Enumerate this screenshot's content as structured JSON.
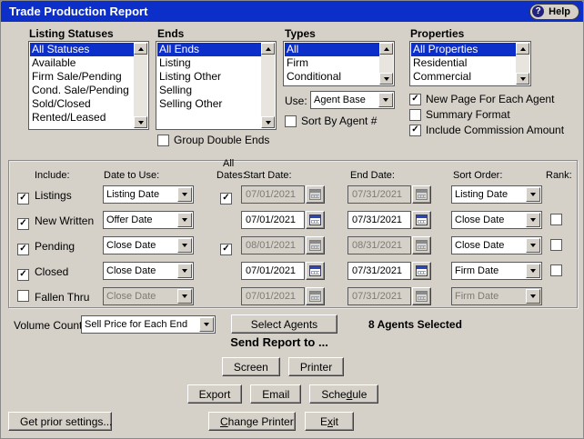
{
  "window": {
    "title": "Trade Production Report",
    "help_label": "Help",
    "help_icon": "?"
  },
  "colors": {
    "titlebar": "#0d2fc9",
    "selection": "#0d2fc9",
    "dialog_bg": "#d5d1c9"
  },
  "lists": {
    "listing_statuses": {
      "label": "Listing Statuses",
      "items": [
        "All Statuses",
        "Available",
        "Firm Sale/Pending",
        "Cond. Sale/Pending",
        "Sold/Closed",
        "Rented/Leased"
      ],
      "selected_index": 0
    },
    "ends": {
      "label": "Ends",
      "items": [
        "All Ends",
        "Listing",
        "Listing Other",
        "Selling",
        "Selling Other"
      ],
      "selected_index": 0,
      "checkbox": {
        "label": "Group Double Ends",
        "checked": false
      }
    },
    "types": {
      "label": "Types",
      "items": [
        "All",
        "Firm",
        "Conditional"
      ],
      "selected_index": 0,
      "use_label": "Use:",
      "use_value": "Agent Base",
      "checkbox": {
        "label": "Sort By Agent #",
        "checked": false
      }
    },
    "properties": {
      "label": "Properties",
      "items": [
        "All Properties",
        "Residential",
        "Commercial"
      ],
      "selected_index": 0,
      "checkboxes": [
        {
          "label": "New Page For Each Agent",
          "checked": true
        },
        {
          "label": "Summary Format",
          "checked": false
        },
        {
          "label": "Include Commission Amount",
          "checked": true
        }
      ]
    }
  },
  "grid": {
    "headers": {
      "include": "Include:",
      "date_to_use": "Date to Use:",
      "all_line1": "All",
      "all_line2": "Dates:",
      "start_date": "Start Date:",
      "end_date": "End Date:",
      "sort_order": "Sort Order:",
      "rank": "Rank:"
    },
    "rows": [
      {
        "label": "Listings",
        "checked": true,
        "date_to_use": "Listing Date",
        "all_dates": true,
        "start": "07/01/2021",
        "end": "07/31/2021",
        "dates_disabled": true,
        "sort": "Listing Date",
        "rank": null,
        "row_disabled": false
      },
      {
        "label": "New Written",
        "checked": true,
        "date_to_use": "Offer Date",
        "all_dates": null,
        "start": "07/01/2021",
        "end": "07/31/2021",
        "dates_disabled": false,
        "sort": "Close Date",
        "rank": false,
        "row_disabled": false
      },
      {
        "label": "Pending",
        "checked": true,
        "date_to_use": "Close Date",
        "all_dates": true,
        "start": "08/01/2021",
        "end": "08/31/2021",
        "dates_disabled": true,
        "sort": "Close Date",
        "rank": false,
        "row_disabled": false
      },
      {
        "label": "Closed",
        "checked": true,
        "date_to_use": "Close Date",
        "all_dates": null,
        "start": "07/01/2021",
        "end": "07/31/2021",
        "dates_disabled": false,
        "sort": "Firm Date",
        "rank": false,
        "row_disabled": false
      },
      {
        "label": "Fallen Thru",
        "checked": false,
        "date_to_use": "Close Date",
        "all_dates": null,
        "start": "07/01/2021",
        "end": "07/31/2021",
        "dates_disabled": true,
        "sort": "Firm Date",
        "rank": null,
        "row_disabled": true
      }
    ]
  },
  "bottom": {
    "volume_count_label": "Volume Count:",
    "volume_count_value": "Sell Price for Each End",
    "select_agents": {
      "label": "Select Agents",
      "u": -1
    },
    "agents_selected": "8 Agents Selected",
    "send_report_to": "Send Report to ...",
    "send_buttons_row1": [
      {
        "label": "Screen",
        "u": -1
      },
      {
        "label": "Printer",
        "u": -1
      }
    ],
    "send_buttons_row2": [
      {
        "label": "Export",
        "u": -1
      },
      {
        "label": "Email",
        "u": -1
      },
      {
        "label": "Schedule",
        "u": 4
      }
    ],
    "get_prior_settings": {
      "label": "Get prior settings...",
      "u": -1
    },
    "change_printer": {
      "label": "Change Printer",
      "u": 0
    },
    "exit": {
      "label": "Exit",
      "u": 1
    }
  }
}
